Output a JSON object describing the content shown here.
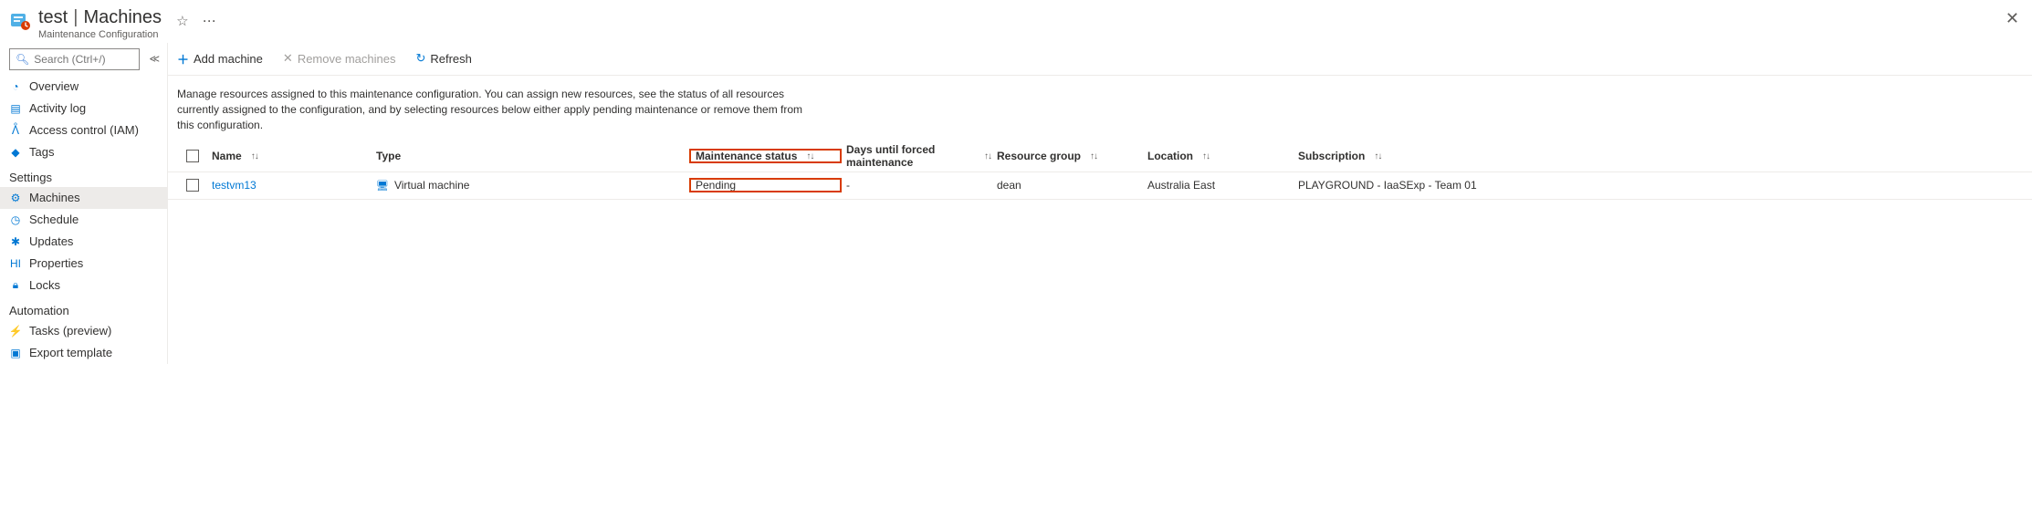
{
  "header": {
    "titlePrefix": "test",
    "titleSuffix": "Machines",
    "subtitle": "Maintenance Configuration"
  },
  "search": {
    "placeholder": "Search (Ctrl+/)"
  },
  "nav": {
    "overview": "Overview",
    "activity": "Activity log",
    "iam": "Access control (IAM)",
    "tags": "Tags",
    "section_settings": "Settings",
    "machines": "Machines",
    "schedule": "Schedule",
    "updates": "Updates",
    "properties": "Properties",
    "locks": "Locks",
    "section_automation": "Automation",
    "tasks": "Tasks (preview)",
    "export": "Export template"
  },
  "toolbar": {
    "add": "Add machine",
    "remove": "Remove machines",
    "refresh": "Refresh"
  },
  "description": "Manage resources assigned to this maintenance configuration. You can assign new resources, see the status of all resources currently assigned to the configuration, and by selecting resources below either apply pending maintenance or remove them from this configuration.",
  "columns": {
    "name": "Name",
    "type": "Type",
    "status": "Maintenance status",
    "days": "Days until forced maintenance",
    "rg": "Resource group",
    "loc": "Location",
    "sub": "Subscription"
  },
  "rows": [
    {
      "name": "testvm13",
      "type": "Virtual machine",
      "status": "Pending",
      "days": "-",
      "rg": "dean",
      "loc": "Australia East",
      "sub": "PLAYGROUND - IaaSExp - Team 01"
    }
  ]
}
